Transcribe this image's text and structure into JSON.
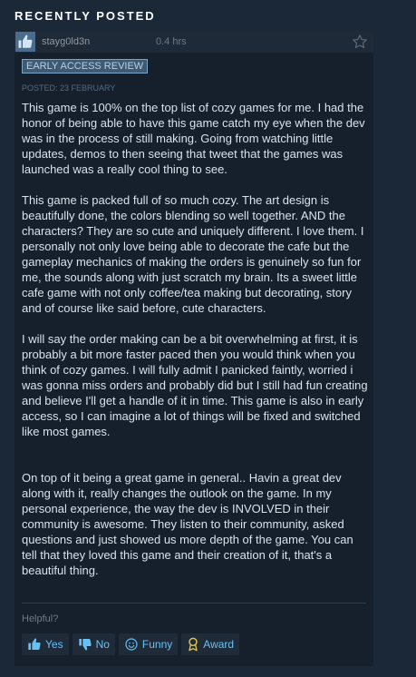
{
  "section": {
    "title": "RECENTLY POSTED"
  },
  "author": {
    "name": "stayg0ld3n",
    "hours": "0.4 hrs"
  },
  "badge": {
    "label": "EARLY ACCESS REVIEW"
  },
  "posted": "POSTED: 23 FEBRUARY",
  "review": {
    "paragraphs": [
      "This game is 100% on the top list of cozy games for me. I had the honor of being able to have this game catch my eye when the dev was in the process of still making. Going from watching little updates, demos to then seeing that tweet that the games was launched was a really cool thing to see.",
      "This game is packed full of so much cozy. The art design is beautifully done, the colors blending so well together. AND the characters? They are so cute and uniquely different. I love them. I personally not only love being able to decorate the cafe but the gameplay mechanics of making the orders is genuinely so fun for me, the sounds along with just scratch my brain. Its a sweet little cafe game with not only coffee/tea making but decorating, story and of course like said before, cute characters.",
      "I will say the order making can be a bit overwhelming at first, it is probably a bit more faster paced then you would think when you think of cozy games. I will fully admit I panicked faintly, worried i was gonna miss orders and probably did but I still had fun creating and believe I'll get a handle of it in time. This game is also in early access, so I can imagine a lot of things will be fixed and switched like most games.",
      "On top of it being a great game in general.. Havin a great dev along with it, really changes the outlook on the game. In my personal experience, the way the dev is INVOLVED in their community is awesome. They listen to their community, asked questions and just showed us more depth of the game. You can tell that they loved this game and their creation of it, that's a beautiful thing."
    ]
  },
  "helpful": {
    "label": "Helpful?",
    "buttons": {
      "yes": "Yes",
      "no": "No",
      "funny": "Funny",
      "award": "Award"
    }
  },
  "icons": {
    "thumbs_up": "thumbs-up-icon",
    "thumbs_down": "thumbs-down-icon",
    "smiley": "smiley-icon",
    "award": "award-icon",
    "star": "star-icon"
  },
  "colors": {
    "background": "#1b2838",
    "card": "#16202d",
    "link": "#67c1f5",
    "badge_bg": "#3f5a73"
  }
}
